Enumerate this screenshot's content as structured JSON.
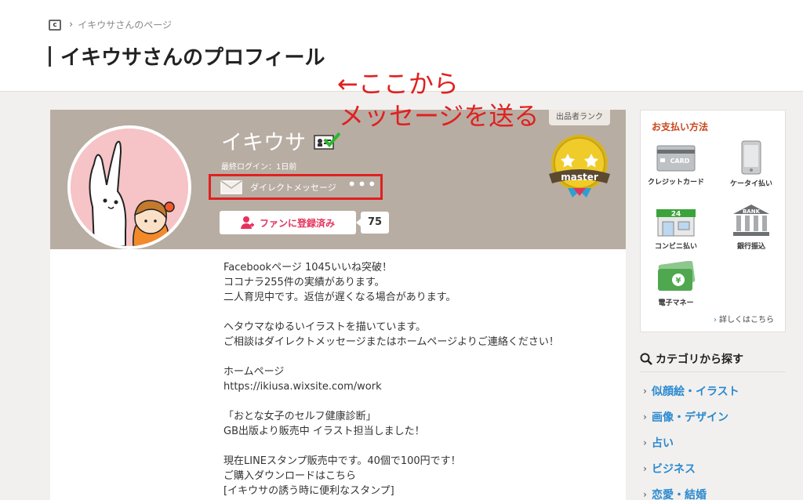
{
  "breadcrumb": {
    "current": "イキウサさんのページ"
  },
  "page": {
    "title": "イキウサさんのプロフィール"
  },
  "profile": {
    "username": "イキウサ",
    "last_login": "最終ログイン：1日前",
    "dm_label": "ダイレクトメッセージ",
    "dm_more": "•••",
    "fan_button": "ファンに登録済み",
    "fan_count": "75",
    "rank_label": "出品者ランク",
    "rank_name": "master"
  },
  "annotation": {
    "line1": "←ここから",
    "line2": "メッセージを送る"
  },
  "bio": [
    "Facebookページ 1045いいね突破！",
    "ココナラ255件の実績があります。",
    "二人育児中です。返信が遅くなる場合があります。",
    "",
    "ヘタウマなゆるいイラストを描いています。",
    "ご相談はダイレクトメッセージまたはホームページよりご連絡ください！",
    "",
    "ホームページ",
    "https://ikiusa.wixsite.com/work",
    "",
    "「おとな女子のセルフ健康診断」",
    "GB出版より販売中 イラスト担当しました！",
    "",
    "現在LINEスタンプ販売中です。40個で100円です！",
    "ご購入ダウンロードはこちら",
    "[イキウサの誘う時に便利なスタンプ]"
  ],
  "payment": {
    "title": "お支払い方法",
    "methods": [
      {
        "label": "クレジットカード",
        "icon": "credit-card-icon",
        "card_text": "CARD"
      },
      {
        "label": "ケータイ払い",
        "icon": "mobile-phone-icon"
      },
      {
        "label": "コンビニ払い",
        "icon": "convenience-store-icon",
        "store_text": "24"
      },
      {
        "label": "銀行振込",
        "icon": "bank-icon",
        "bank_text": "BANK"
      },
      {
        "label": "電子マネー",
        "icon": "e-money-icon",
        "yen_text": "¥"
      }
    ],
    "more_link": "詳しくはこちら"
  },
  "categories": {
    "title": "カテゴリから探す",
    "items": [
      "似顔絵・イラスト",
      "画像・デザイン",
      "占い",
      "ビジネス",
      "恋愛・結婚"
    ]
  },
  "colors": {
    "accent_red": "#e02020",
    "fan_pink": "#e5325c",
    "category_blue": "#2a8ad0",
    "header_brown": "#b8ada3"
  }
}
